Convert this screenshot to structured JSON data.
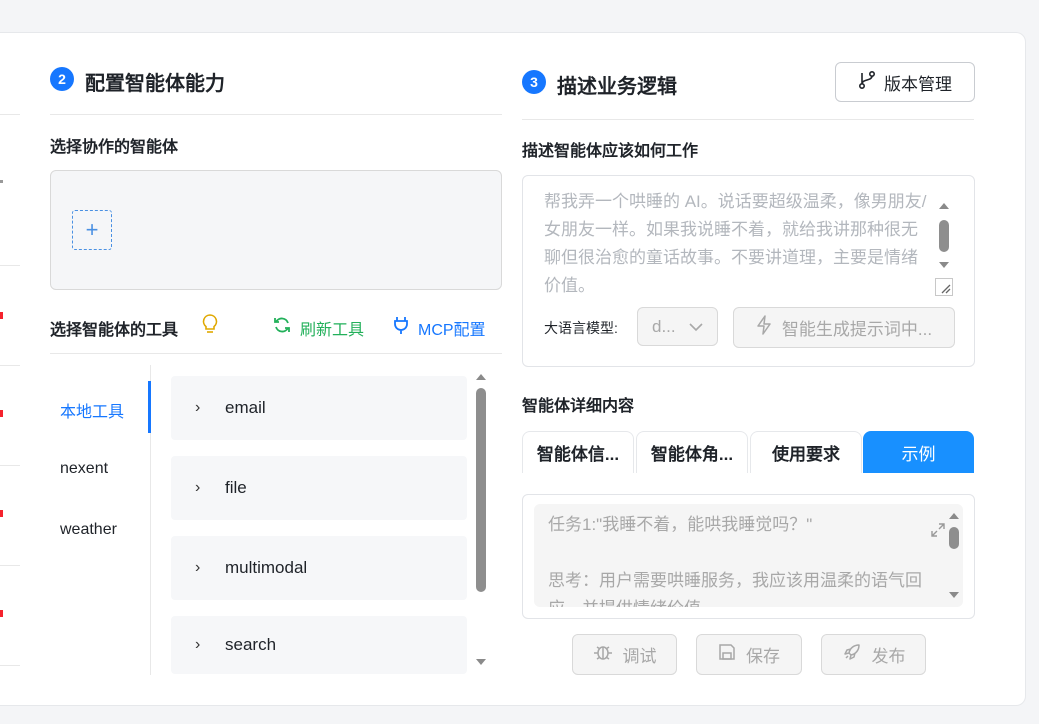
{
  "step2": {
    "number": "2",
    "title": "配置智能体能力",
    "collab_label": "选择协作的智能体",
    "add_symbol": "+",
    "tools_label": "选择智能体的工具",
    "refresh_label": "刷新工具",
    "mcp_label": "MCP配置",
    "tool_tabs": [
      "本地工具",
      "nexent",
      "weather"
    ],
    "active_tab": "本地工具",
    "tools": [
      "email",
      "file",
      "multimodal",
      "search"
    ]
  },
  "step3": {
    "number": "3",
    "title": "描述业务逻辑",
    "version_label": "版本管理",
    "desc_label": "描述智能体应该如何工作",
    "desc_placeholder": "帮我弄一个哄睡的 AI。说话要超级温柔，像男朋友/女朋友一样。如果我说睡不着，就给我讲那种很无聊但很治愈的童话故事。不要讲道理，主要是情绪价值。",
    "model_label": "大语言模型:",
    "model_value": "d...",
    "generate_label": "智能生成提示词中...",
    "detail_label": "智能体详细内容",
    "detail_tabs": [
      "智能体信...",
      "智能体角...",
      "使用要求",
      "示例"
    ],
    "active_detail_tab": "示例",
    "example_text": "任务1:\"我睡不着，能哄我睡觉吗？\"\n\n思考：用户需要哄睡服务，我应该用温柔的语气回应，并提供情绪价值。",
    "debug_label": "调试",
    "save_label": "保存",
    "publish_label": "发布"
  },
  "colors": {
    "accent": "#1677ff",
    "green": "#22b05a",
    "active_tab_bg": "#1890ff",
    "warning_red": "#f5222d"
  },
  "icons": {
    "refresh": "refresh-icon",
    "mcp": "plug-icon",
    "version": "branch-icon",
    "hint": "lightbulb-icon",
    "generate": "lightning-icon",
    "debug": "bug-icon",
    "save": "save-icon",
    "publish": "rocket-icon"
  }
}
